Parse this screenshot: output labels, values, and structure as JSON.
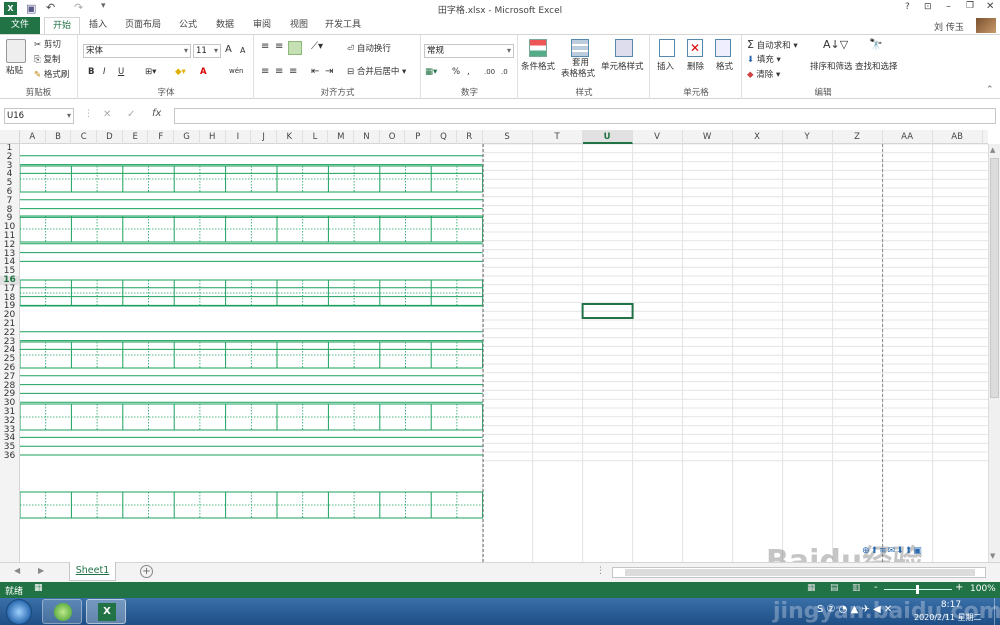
{
  "window": {
    "title": "田字格.xlsx - Microsoft Excel",
    "help": "?",
    "user": "刘 传玉"
  },
  "tabs": [
    "文件",
    "开始",
    "插入",
    "页面布局",
    "公式",
    "数据",
    "审阅",
    "视图",
    "开发工具"
  ],
  "ribbon": {
    "clipboard": {
      "label": "剪贴板",
      "paste": "粘贴",
      "cut": "剪切",
      "copy": "复制",
      "format_painter": "格式刷"
    },
    "font": {
      "label": "字体",
      "name": "宋体",
      "size": "11",
      "bold": "B",
      "italic": "I",
      "underline": "U",
      "grow": "A",
      "shrink": "A",
      "fontcolor": "A",
      "wen": "wén"
    },
    "alignment": {
      "label": "对齐方式",
      "wrap": "自动换行",
      "merge": "合并后居中"
    },
    "number": {
      "label": "数字",
      "format": "常规",
      "percent": "%",
      "comma": ","
    },
    "styles": {
      "label": "样式",
      "cond": "条件格式",
      "table1": "套用",
      "table2": "表格格式",
      "cellstyle": "单元格样式"
    },
    "cells": {
      "label": "单元格",
      "insert": "插入",
      "delete": "删除",
      "format": "格式"
    },
    "editing": {
      "label": "编辑",
      "autosum": "自动求和",
      "fill": "填充",
      "clear": "清除",
      "sort": "排序和筛选",
      "find": "查找和选择"
    }
  },
  "formula_bar": {
    "namebox": "U16",
    "fx": "fx",
    "value": ""
  },
  "columns": [
    "A",
    "B",
    "C",
    "D",
    "E",
    "F",
    "G",
    "H",
    "I",
    "J",
    "K",
    "L",
    "M",
    "N",
    "O",
    "P",
    "Q",
    "R",
    "S",
    "T",
    "U",
    "V",
    "W",
    "X",
    "Y",
    "Z",
    "AA",
    "AB"
  ],
  "rows": [
    "1",
    "2",
    "3",
    "4",
    "5",
    "6",
    "7",
    "8",
    "9",
    "10",
    "11",
    "12",
    "13",
    "14",
    "15",
    "16",
    "17",
    "18",
    "19",
    "20",
    "21",
    "22",
    "23",
    "24",
    "25",
    "26",
    "27",
    "28",
    "29",
    "30",
    "31",
    "32",
    "33",
    "34",
    "35",
    "36"
  ],
  "selected_cell": {
    "col": "U",
    "row": "16"
  },
  "sheet": {
    "tab": "Sheet1",
    "add": "+"
  },
  "status": {
    "ready": "就绪",
    "zoom": "100%",
    "minus": "-",
    "plus": "+"
  },
  "taskbar": {
    "time": "8:17",
    "date": "2020/2/11 星期二"
  },
  "watermark": {
    "line1": "Baidu经验",
    "line2": "jingyan.baidu.com"
  },
  "colors": {
    "excel_green": "#217346",
    "grid_green": "#1aa15e",
    "taskbar": "#2a5f9a"
  }
}
